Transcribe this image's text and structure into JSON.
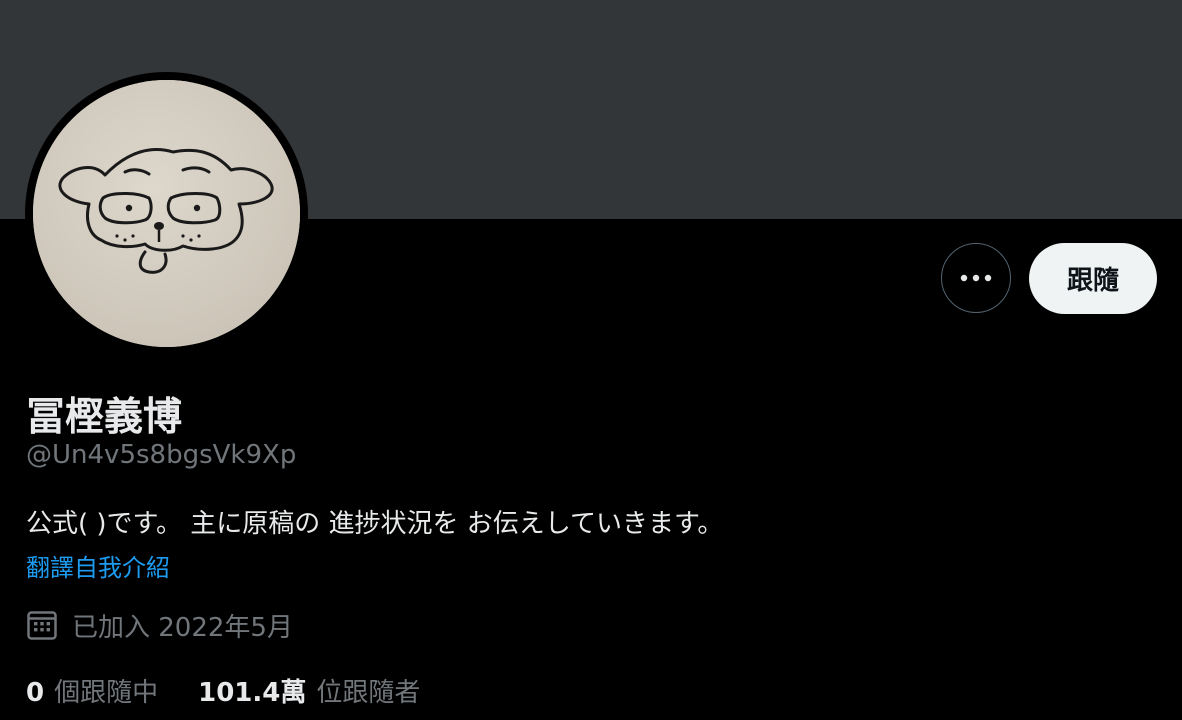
{
  "profile": {
    "name": "冨樫義博",
    "handle": "@Un4v5s8bgsVk9Xp",
    "bio": "公式( )です。 主に原稿の 進捗状況を お伝えしていきます。",
    "translate_label": "翻譯自我介紹",
    "joined": "已加入 2022年5月",
    "following_count": "0",
    "following_label": "個跟隨中",
    "followers_count": "101.4萬",
    "followers_label": "位跟隨者"
  },
  "actions": {
    "follow_label": "跟隨",
    "more_icon": "more-horizontal-icon"
  },
  "icons": {
    "calendar": "calendar-icon",
    "avatar": "dog-drawing-avatar"
  },
  "colors": {
    "background": "#000000",
    "banner": "#333639",
    "text_primary": "#e7e9ea",
    "text_secondary": "#71767b",
    "link": "#1d9bf0",
    "follow_button_bg": "#eff3f4"
  }
}
